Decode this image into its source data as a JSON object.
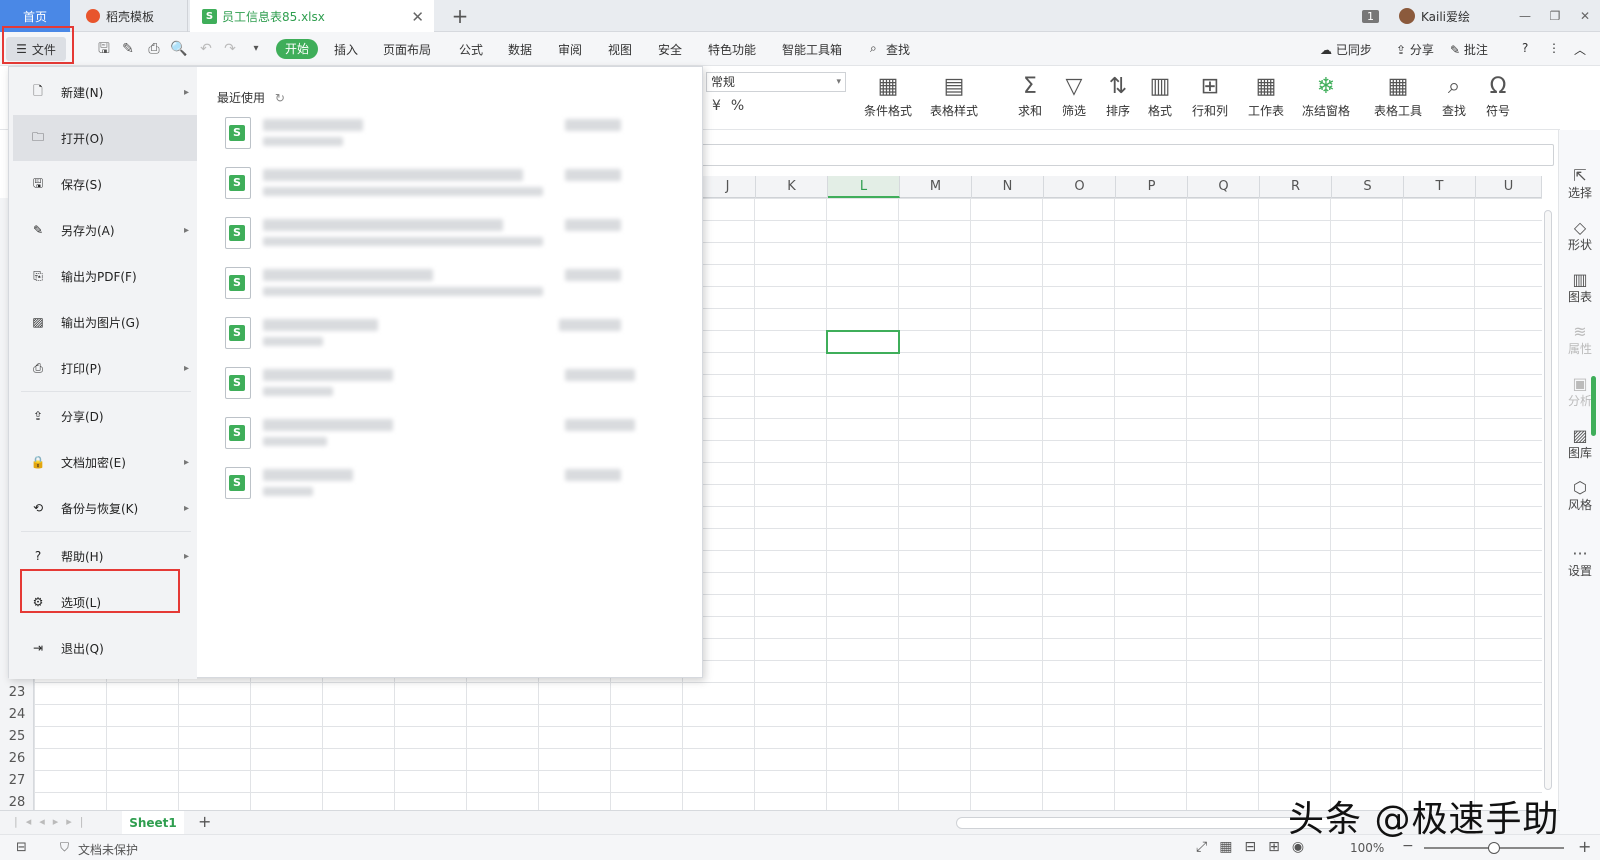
{
  "tabs": {
    "home": "首页",
    "daoke": "稻壳模板",
    "file": "员工信息表85.xlsx",
    "page_badge": "1",
    "user": "Kaili爱绘"
  },
  "toolbar": {
    "file_label": "文件",
    "menus": [
      "开始",
      "插入",
      "页面布局",
      "公式",
      "数据",
      "审阅",
      "视图",
      "安全",
      "特色功能",
      "智能工具箱"
    ],
    "search_label": "查找",
    "sync": "已同步",
    "share": "分享",
    "comment": "批注"
  },
  "ribbon": {
    "format_value": "常规",
    "buttons": [
      "条件格式",
      "表格样式",
      "求和",
      "筛选",
      "排序",
      "格式",
      "行和列",
      "工作表",
      "冻结窗格",
      "表格工具",
      "查找",
      "符号"
    ]
  },
  "grid": {
    "columns": [
      "J",
      "K",
      "L",
      "M",
      "N",
      "O",
      "P",
      "Q",
      "R",
      "S",
      "T",
      "U"
    ],
    "rows": [
      "23",
      "24",
      "25",
      "26",
      "27",
      "28"
    ]
  },
  "file_menu": {
    "items": [
      {
        "label": "新建(N)",
        "icon": "new-file-icon",
        "arrow": true
      },
      {
        "label": "打开(O)",
        "icon": "folder-open-icon",
        "arrow": false
      },
      {
        "label": "保存(S)",
        "icon": "save-icon",
        "arrow": false
      },
      {
        "label": "另存为(A)",
        "icon": "save-as-icon",
        "arrow": true
      },
      {
        "label": "输出为PDF(F)",
        "icon": "export-pdf-icon",
        "arrow": false
      },
      {
        "label": "输出为图片(G)",
        "icon": "export-image-icon",
        "arrow": false
      },
      {
        "label": "打印(P)",
        "icon": "print-icon",
        "arrow": true
      },
      {
        "label": "分享(D)",
        "icon": "share-icon",
        "arrow": false
      },
      {
        "label": "文档加密(E)",
        "icon": "encrypt-icon",
        "arrow": true
      },
      {
        "label": "备份与恢复(K)",
        "icon": "backup-icon",
        "arrow": true
      },
      {
        "label": "帮助(H)",
        "icon": "help-icon",
        "arrow": true
      },
      {
        "label": "选项(L)",
        "icon": "gear-icon",
        "arrow": false
      },
      {
        "label": "退出(Q)",
        "icon": "exit-icon",
        "arrow": false
      }
    ],
    "recent_title": "最近使用"
  },
  "side_panel": [
    "选择",
    "形状",
    "图表",
    "属性",
    "分析",
    "图库",
    "风格",
    "设置"
  ],
  "sheet": {
    "tab": "Sheet1"
  },
  "status": {
    "protect": "文档未保护",
    "zoom": "100%"
  },
  "watermark": "头条 @极速手助",
  "colors": {
    "accent_green": "#3fae5a",
    "highlight_red": "#e53935",
    "home_tab_blue": "#4a88e6"
  }
}
